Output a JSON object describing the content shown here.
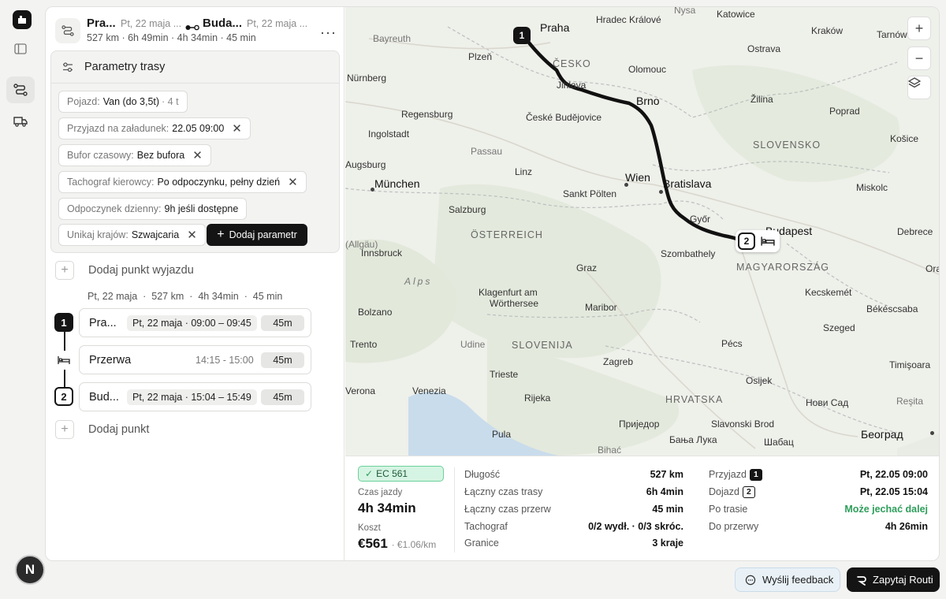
{
  "route": {
    "origin_short": "Pra...",
    "origin_date": "Pt, 22 maja ...",
    "dest_short": "Buda...",
    "dest_date": "Pt, 22 maja ...",
    "stats": "527 km · 6h 49min · 4h 34min · 45 min",
    "more": "···"
  },
  "params": {
    "title": "Parametry trasy",
    "chips": [
      {
        "label": "Pojazd:",
        "value": "Van (do 3,5t)",
        "sub": "· 4 t"
      },
      {
        "label": "Przyjazd na załadunek:",
        "value": "22.05 09:00"
      },
      {
        "label": "Bufor czasowy:",
        "value": "Bez bufora"
      },
      {
        "label": "Tachograf kierowcy:",
        "value": "Po odpoczynku, pełny dzień"
      },
      {
        "label": "Odpoczynek dzienny:",
        "value": "9h jeśli dostępne"
      },
      {
        "label": "Unikaj krajów:",
        "value": "Szwajcaria"
      }
    ],
    "add_label": "Dodaj parametr"
  },
  "add_departure": "Dodaj punkt wyjazdu",
  "day_summary": "Pt, 22 maja  ·  527 km  ·  4h 34min  ·  45 min",
  "stops": [
    {
      "marker": "1",
      "name": "Pra...",
      "time": "Pt, 22 maja · 09:00 – 09:45",
      "dur": "45m"
    },
    {
      "name": "Przerwa",
      "time": "14:15 - 15:00",
      "dur": "45m"
    },
    {
      "marker": "2",
      "name": "Bud...",
      "time": "Pt, 22 maja · 15:04 – 15:49",
      "dur": "45m"
    }
  ],
  "add_point": "Dodaj punkt",
  "map": {
    "pin1": "1",
    "pin2": "2",
    "cities": [
      {
        "name": "Praha",
        "cls": "big"
      },
      {
        "name": "Hradec Králové"
      },
      {
        "name": "Nysa",
        "cls": "muted"
      },
      {
        "name": "Katowice"
      },
      {
        "name": "Kraków"
      },
      {
        "name": "Tarnów"
      },
      {
        "name": "Bayreuth"
      },
      {
        "name": "Plzeň"
      },
      {
        "name": "ČESKO",
        "cls": "country"
      },
      {
        "name": "Olomouc"
      },
      {
        "name": "Ostrava"
      },
      {
        "name": "Nürnberg"
      },
      {
        "name": "Jihlava"
      },
      {
        "name": "Brno",
        "cls": "big"
      },
      {
        "name": "Žilina"
      },
      {
        "name": "Poprad"
      },
      {
        "name": "Regensburg"
      },
      {
        "name": "České Budějovice"
      },
      {
        "name": "Ingolstadt"
      },
      {
        "name": "SLOVENSKO",
        "cls": "country"
      },
      {
        "name": "Košice"
      },
      {
        "name": "Passau"
      },
      {
        "name": "Augsburg"
      },
      {
        "name": "Linz"
      },
      {
        "name": "Wien",
        "cls": "big"
      },
      {
        "name": "Bratislava",
        "cls": "big"
      },
      {
        "name": "Miskolc"
      },
      {
        "name": "München",
        "cls": "big"
      },
      {
        "name": "Sankt Pölten"
      },
      {
        "name": "Salzburg"
      },
      {
        "name": "Győr"
      },
      {
        "name": "Budapest",
        "cls": "big"
      },
      {
        "name": "Debrece"
      },
      {
        "name": "(Allgäu)"
      },
      {
        "name": "ÖSTERREICH",
        "cls": "country"
      },
      {
        "name": "Innsbruck"
      },
      {
        "name": "Szombathely"
      },
      {
        "name": "Graz"
      },
      {
        "name": "MAGYARORSZÁG",
        "cls": "country"
      },
      {
        "name": "Orad"
      },
      {
        "name": "Alps",
        "cls": "muted"
      },
      {
        "name": "Klagenfurt am"
      },
      {
        "name": "Wörthersee"
      },
      {
        "name": "Kecskemét"
      },
      {
        "name": "Bolzano"
      },
      {
        "name": "Maribor"
      },
      {
        "name": "Békéscsaba"
      },
      {
        "name": "Trento"
      },
      {
        "name": "Udine"
      },
      {
        "name": "SLOVENIJA",
        "cls": "country"
      },
      {
        "name": "Pécs"
      },
      {
        "name": "Szeged"
      },
      {
        "name": "Trieste"
      },
      {
        "name": "Zagreb"
      },
      {
        "name": "Timişoara"
      },
      {
        "name": "Verona"
      },
      {
        "name": "Venezia"
      },
      {
        "name": "Osijek"
      },
      {
        "name": "Rijeka"
      },
      {
        "name": "HRVATSKA",
        "cls": "country"
      },
      {
        "name": "Нови Сад"
      },
      {
        "name": "Reşita"
      },
      {
        "name": "Приједор"
      },
      {
        "name": "Slavonski Brod"
      },
      {
        "name": "Pula"
      },
      {
        "name": "Бања Лука"
      },
      {
        "name": "Београд",
        "cls": "big"
      },
      {
        "name": "Bihać"
      },
      {
        "name": "Шабац"
      }
    ]
  },
  "summary": {
    "badge": "EC 561",
    "drive_label": "Czas jazdy",
    "drive_value": "4h 34min",
    "cost_label": "Koszt",
    "cost_value": "€561",
    "cost_per_km": "· €1.06/km",
    "metrics": [
      {
        "k": "Długość",
        "v": "527 km"
      },
      {
        "k": "Łączny czas trasy",
        "v": "6h 4min"
      },
      {
        "k": "Łączny czas przerw",
        "v": "45 min"
      },
      {
        "k": "Tachograf",
        "v": "0/2 wydł. · 0/3 skróc."
      },
      {
        "k": "Granice",
        "v": "3 kraje"
      }
    ],
    "arrival_label": "Przyjazd",
    "arrival_value": "Pt, 22.05 09:00",
    "depart_label": "Dojazd",
    "depart_value": "Pt, 22.05 15:04",
    "route_label": "Po trasie",
    "route_value": "Może jechać dalej",
    "break_label": "Do przerwy",
    "break_value": "4h 26min"
  },
  "buttons": {
    "feedback": "Wyślij feedback",
    "ask": "Zapytaj Routi"
  },
  "avatar": "N",
  "colors": {
    "accent": "#141414",
    "success": "#2e9e5b",
    "badge_bg": "#d6f4e3"
  }
}
